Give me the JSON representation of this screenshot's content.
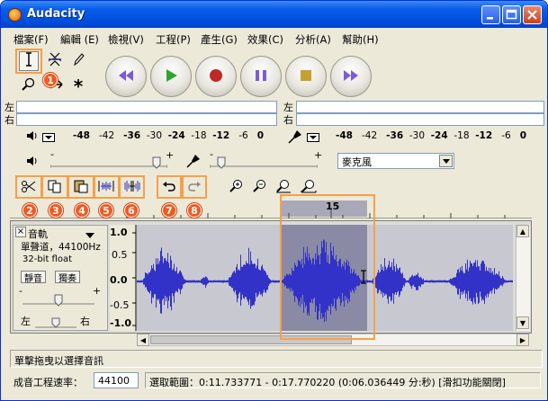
{
  "window": {
    "title": "Audacity"
  },
  "menu": [
    "檔案(F)",
    "編輯 (E)",
    "檢視(V)",
    "工程(P)",
    "產生(G)",
    "效果(C)",
    "分析(A)",
    "幫助(H)"
  ],
  "badges": [
    "1",
    "2",
    "3",
    "4",
    "5",
    "6",
    "7",
    "8"
  ],
  "meters": {
    "left": "左",
    "right": "右"
  },
  "scale": {
    "playback": [
      "-48",
      "-42",
      "-36",
      "-30",
      "-24",
      "-18",
      "-12",
      "-6",
      "0"
    ],
    "record": [
      "-48",
      "-42",
      "-36",
      "-30",
      "-24",
      "-18",
      "-12",
      "-6",
      "0"
    ]
  },
  "mixer": {
    "minus": "-",
    "plus": "+",
    "input_source": "麥克風"
  },
  "timeline": {
    "mark": "15"
  },
  "track": {
    "name": "音軌",
    "close": "×",
    "info": "單聲道，44100Hz",
    "format": "32-bit float",
    "mute": "靜音",
    "solo": "獨奏",
    "gain_minus": "-",
    "gain_plus": "+",
    "pan_left": "左",
    "pan_right": "右",
    "vaxis": [
      "1.0",
      "0.5",
      "0.0",
      "-0.5",
      "-1.0"
    ]
  },
  "status": {
    "message": "單擊拖曳以選擇音訊",
    "rate_label": "成音工程速率：",
    "rate_value": "44100",
    "selection": "選取範圍：0:11.733771 - 0:17.770220 (0:06.036449 分:秒)  [滑扣功能關閉]"
  },
  "colors": {
    "waveform": "#3232c8",
    "selection": "#8a8aa4",
    "highlight": "#f5a04a",
    "badge": "#f05a1e"
  }
}
